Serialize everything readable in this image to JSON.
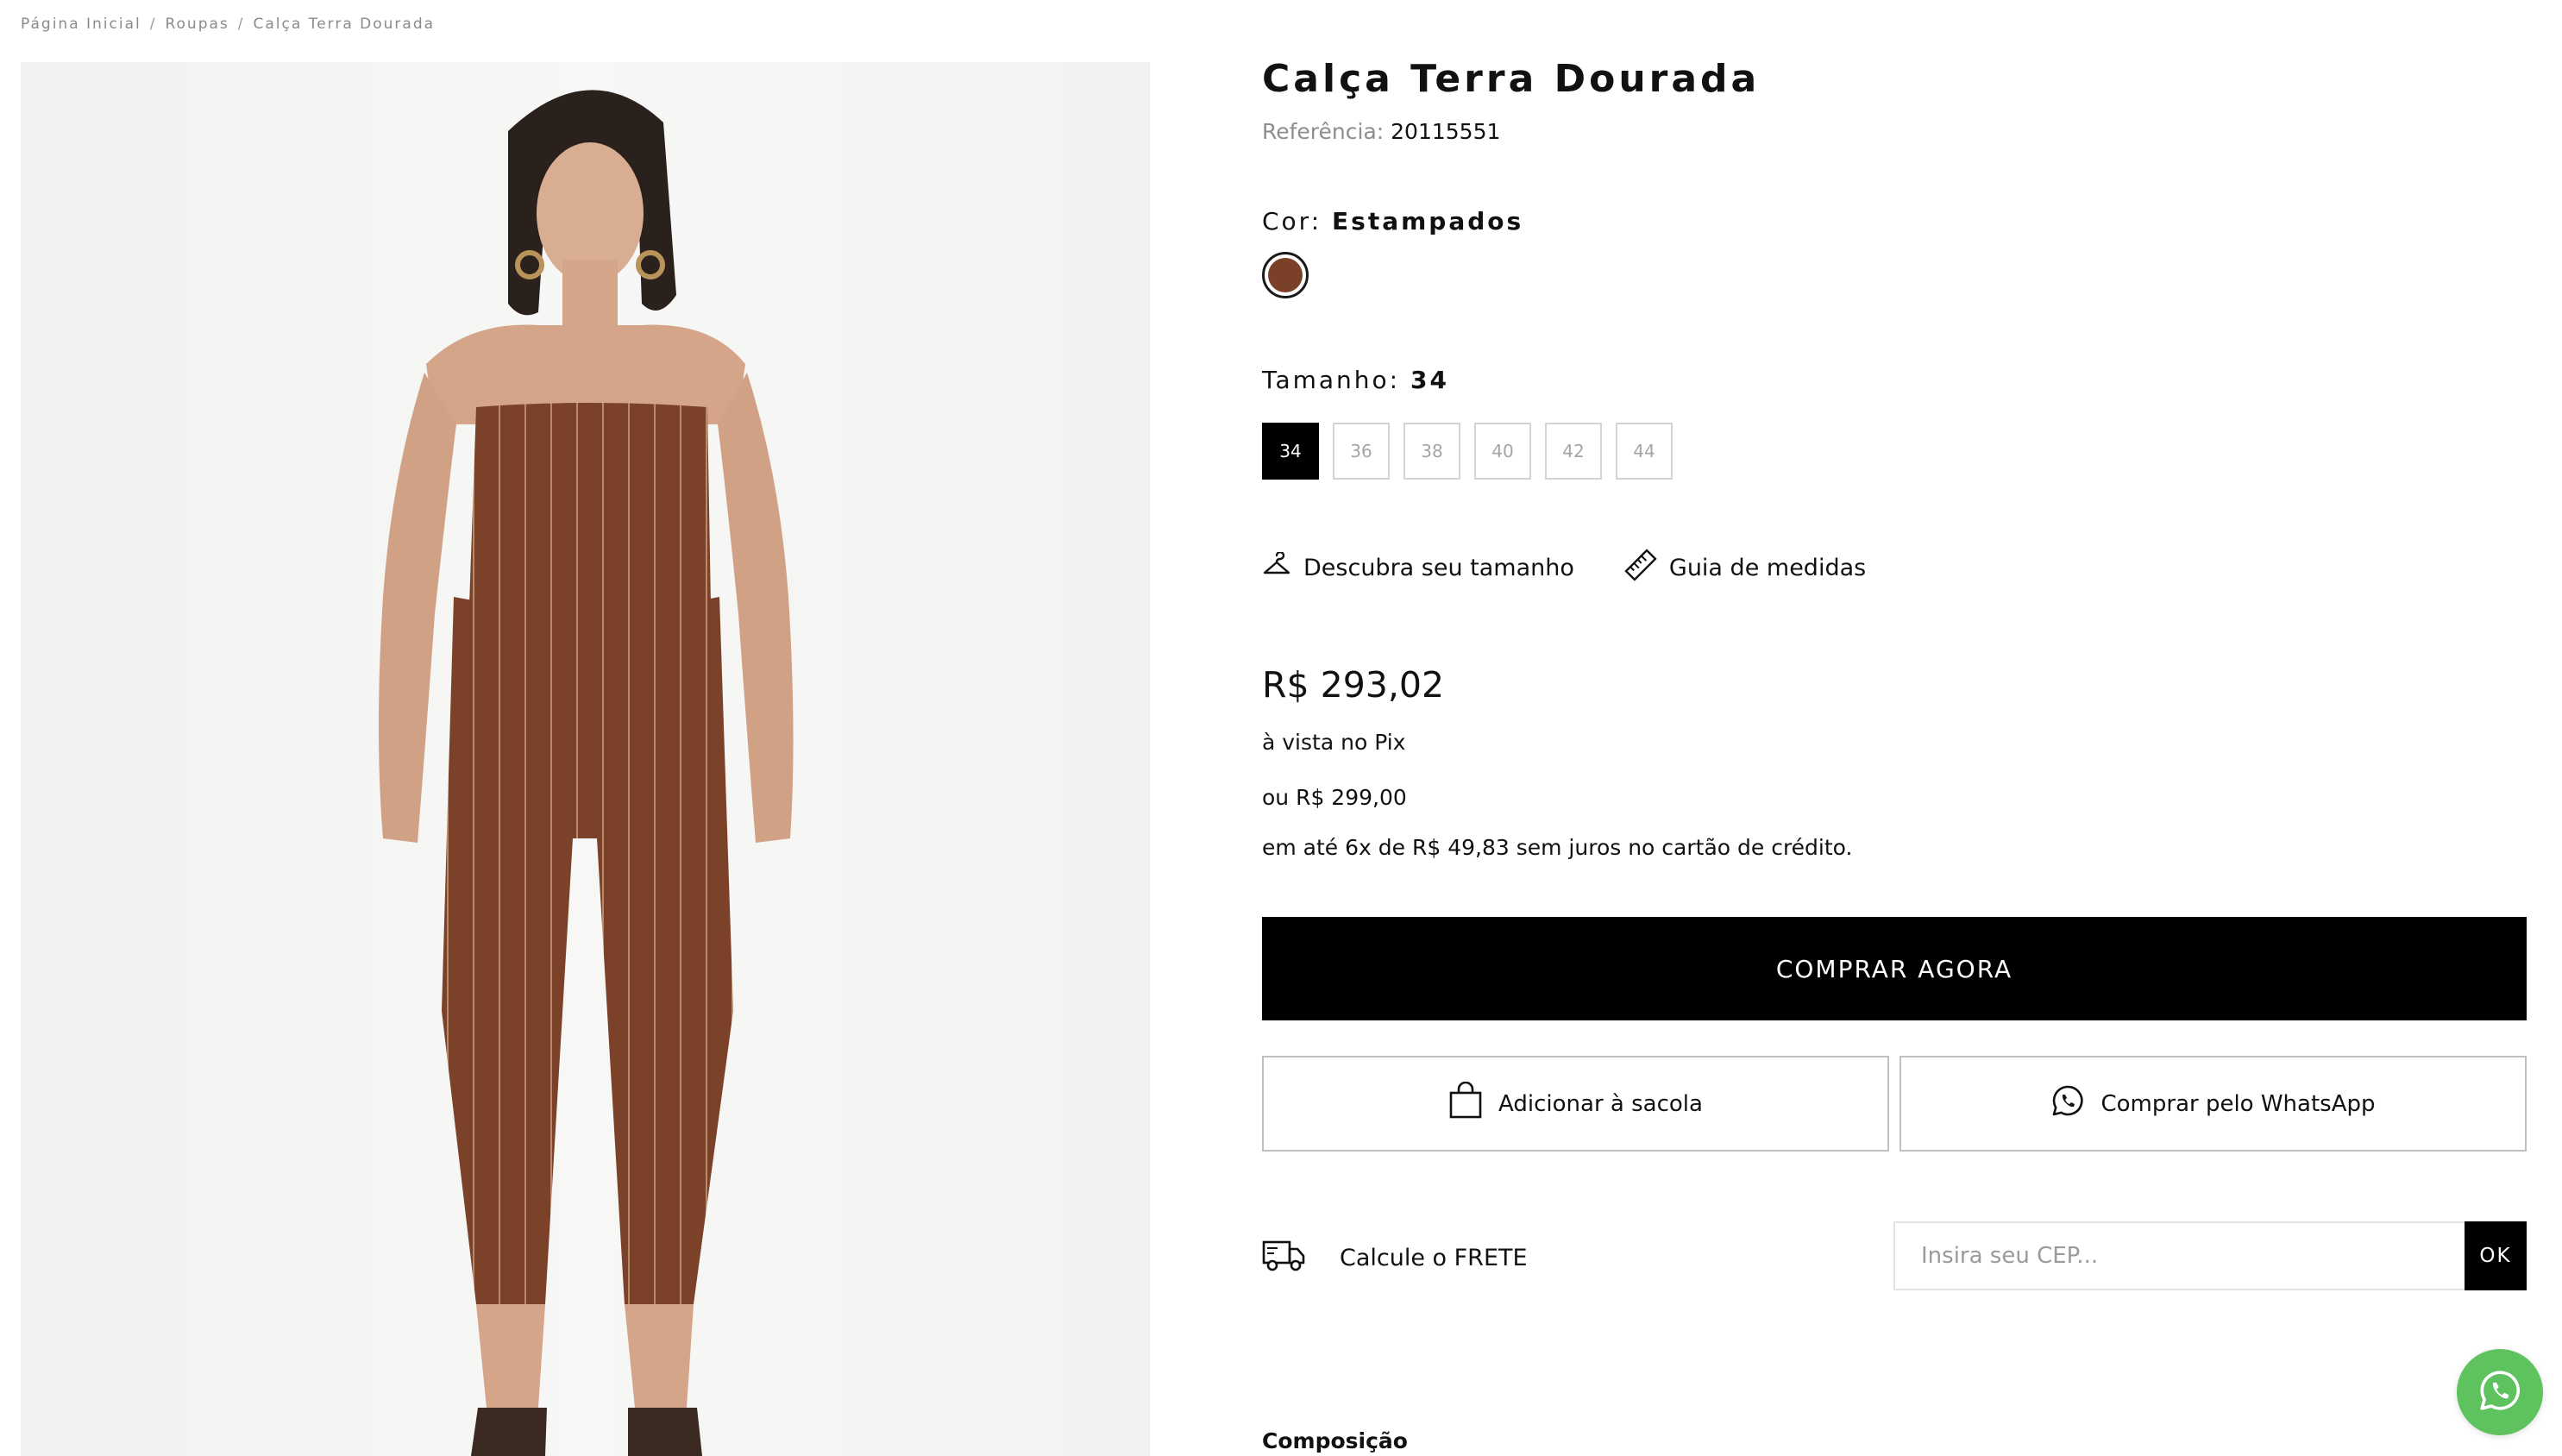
{
  "breadcrumb": {
    "home": "Página Inicial",
    "category": "Roupas",
    "current": "Calça Terra Dourada",
    "separator": "/"
  },
  "product": {
    "title": "Calça Terra Dourada",
    "reference_label": "Referência:",
    "reference_value": "20115551",
    "image_icon": "product-photo-model-striped-brown-set"
  },
  "color": {
    "label": "Cor:",
    "selected": "Estampados",
    "swatch_hex": "#7a4028"
  },
  "size": {
    "label": "Tamanho:",
    "selected": "34",
    "options": [
      "34",
      "36",
      "38",
      "40",
      "42",
      "44"
    ]
  },
  "size_tools": {
    "discover_label": "Descubra seu tamanho",
    "discover_icon": "hanger-icon",
    "guide_label": "Guia de medidas",
    "guide_icon": "ruler-icon"
  },
  "pricing": {
    "price": "R$ 293,02",
    "pix_label": "à vista no Pix",
    "alt_price": "ou R$ 299,00",
    "installments": "em até 6x de R$ 49,83 sem juros no cartão de crédito."
  },
  "actions": {
    "buy_now": "COMPRAR AGORA",
    "add_to_bag": "Adicionar à sacola",
    "add_to_bag_icon": "shopping-bag-icon",
    "whatsapp_buy": "Comprar pelo WhatsApp",
    "whatsapp_icon": "whatsapp-icon"
  },
  "shipping": {
    "label": "Calcule o FRETE",
    "icon": "truck-icon",
    "cep_placeholder": "Insira seu CEP...",
    "ok_label": "OK"
  },
  "composition": {
    "heading": "Composição"
  },
  "colors": {
    "brand_black": "#000000",
    "whatsapp_green": "#5ec25f",
    "muted_text": "#8e8e8e"
  }
}
